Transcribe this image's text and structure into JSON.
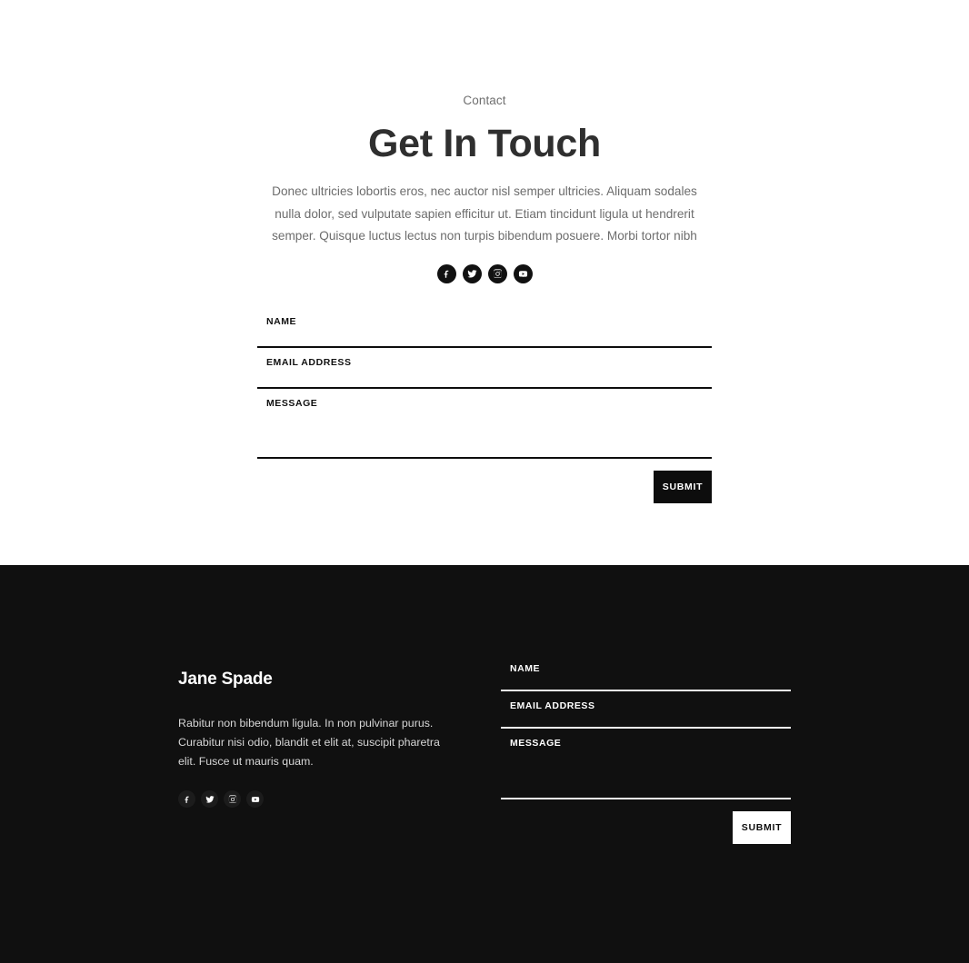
{
  "theme": {
    "light_bg": "#ffffff",
    "dark_bg": "#101010",
    "accent": "#0d0d0d",
    "heading_color": "#2f2f2f",
    "muted_text": "#6d6d6d"
  },
  "contact": {
    "eyebrow": "Contact",
    "heading": "Get In Touch",
    "lead": "Donec ultricies lobortis eros, nec auctor nisl semper ultricies. Aliquam sodales nulla dolor, sed vulputate sapien efficitur ut. Etiam tincidunt ligula ut hendrerit semper. Quisque luctus lectus non turpis bibendum posuere. Morbi tortor nibh",
    "socials": [
      {
        "name": "facebook",
        "icon": "facebook-icon"
      },
      {
        "name": "twitter",
        "icon": "twitter-icon"
      },
      {
        "name": "instagram",
        "icon": "instagram-icon"
      },
      {
        "name": "youtube",
        "icon": "youtube-icon"
      }
    ],
    "form": {
      "name_label": "NAME",
      "name_value": "",
      "name_placeholder": "",
      "email_label": "EMAIL ADDRESS",
      "email_value": "",
      "email_placeholder": "",
      "message_label": "MESSAGE",
      "message_value": "",
      "message_placeholder": "",
      "submit_label": "SUBMIT"
    }
  },
  "footer": {
    "brand": "Jane Spade",
    "about": "Rabitur non bibendum ligula. In non pulvinar purus. Curabitur nisi odio, blandit et elit at, suscipit pharetra elit. Fusce ut mauris quam.",
    "socials": [
      {
        "name": "facebook",
        "icon": "facebook-icon"
      },
      {
        "name": "twitter",
        "icon": "twitter-icon"
      },
      {
        "name": "instagram",
        "icon": "instagram-icon"
      },
      {
        "name": "youtube",
        "icon": "youtube-icon"
      }
    ],
    "form": {
      "name_label": "NAME",
      "name_value": "",
      "name_placeholder": "",
      "email_label": "EMAIL ADDRESS",
      "email_value": "",
      "email_placeholder": "",
      "message_label": "MESSAGE",
      "message_value": "",
      "message_placeholder": "",
      "submit_label": "SUBMIT"
    }
  }
}
